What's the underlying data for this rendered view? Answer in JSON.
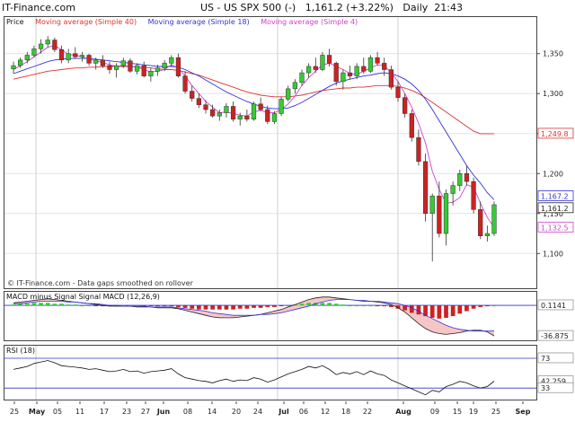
{
  "header": {
    "site": "IT-Finance.com",
    "ticker_line": "US - US SPX 500 (-)   1,161.2 (+3.22%)   Daily  21:43"
  },
  "main_legend": {
    "price_label": "Price",
    "ma40_label": "Moving average (Simple 40)",
    "ma18_label": "Moving average (Simple 18)",
    "ma4_label": "Moving average (Simple 4)",
    "source_note": "© IT-Finance.com - Data gaps smoothed on rollover"
  },
  "macd_legend": {
    "label": "MACD minus Signal Signal MACD (12,26,9)"
  },
  "rsi_legend": {
    "label": "RSI (18)"
  },
  "colors": {
    "up": "#33cc33",
    "down": "#cc2222",
    "ma40": "#dd3333",
    "ma18": "#3333dd",
    "ma4": "#cc44cc",
    "macd_fill": "#f4b8b8",
    "rsi_line": "#111111",
    "guide": "#3333cc"
  },
  "chart_data": [
    {
      "type": "candlestick",
      "panel": "price",
      "yticks": [
        "1,350",
        "1,300",
        "1,250",
        "1,200",
        "1,150",
        "1,100"
      ],
      "ylim": [
        1070,
        1380
      ],
      "xticks": [
        "25",
        "May",
        "05",
        "11",
        "17",
        "23",
        "27",
        "Jun",
        "08",
        "14",
        "20",
        "24",
        "Jul",
        "06",
        "12",
        "18",
        "22",
        "Aug",
        "09",
        "15",
        "19",
        "25",
        "Sep"
      ],
      "value_badges": [
        {
          "text": "1,249.8",
          "color": "#dd3333"
        },
        {
          "text": "1,167.2",
          "color": "#3333dd"
        },
        {
          "text": "1,161.2",
          "color": "#222222"
        },
        {
          "text": "1,132.5",
          "color": "#cc44cc"
        }
      ],
      "candles_ohlc": [
        [
          1331,
          1340,
          1325,
          1335
        ],
        [
          1335,
          1345,
          1332,
          1342
        ],
        [
          1342,
          1352,
          1338,
          1348
        ],
        [
          1348,
          1360,
          1345,
          1356
        ],
        [
          1356,
          1368,
          1350,
          1362
        ],
        [
          1362,
          1372,
          1358,
          1367
        ],
        [
          1367,
          1370,
          1352,
          1355
        ],
        [
          1355,
          1360,
          1338,
          1342
        ],
        [
          1342,
          1356,
          1338,
          1350
        ],
        [
          1350,
          1358,
          1344,
          1346
        ],
        [
          1346,
          1352,
          1340,
          1348
        ],
        [
          1348,
          1350,
          1335,
          1338
        ],
        [
          1338,
          1345,
          1330,
          1342
        ],
        [
          1342,
          1348,
          1332,
          1335
        ],
        [
          1335,
          1340,
          1325,
          1330
        ],
        [
          1330,
          1338,
          1320,
          1335
        ],
        [
          1335,
          1345,
          1332,
          1341
        ],
        [
          1341,
          1344,
          1326,
          1328
        ],
        [
          1328,
          1338,
          1324,
          1335
        ],
        [
          1335,
          1340,
          1320,
          1322
        ],
        [
          1322,
          1332,
          1315,
          1328
        ],
        [
          1328,
          1336,
          1322,
          1332
        ],
        [
          1332,
          1342,
          1328,
          1338
        ],
        [
          1338,
          1348,
          1334,
          1345
        ],
        [
          1345,
          1350,
          1320,
          1322
        ],
        [
          1322,
          1328,
          1300,
          1303
        ],
        [
          1303,
          1310,
          1290,
          1294
        ],
        [
          1294,
          1300,
          1282,
          1286
        ],
        [
          1286,
          1292,
          1275,
          1280
        ],
        [
          1280,
          1286,
          1270,
          1272
        ],
        [
          1272,
          1280,
          1266,
          1276
        ],
        [
          1276,
          1288,
          1270,
          1284
        ],
        [
          1284,
          1290,
          1265,
          1268
        ],
        [
          1268,
          1276,
          1260,
          1272
        ],
        [
          1272,
          1280,
          1265,
          1268
        ],
        [
          1268,
          1290,
          1266,
          1287
        ],
        [
          1287,
          1295,
          1278,
          1280
        ],
        [
          1280,
          1285,
          1262,
          1265
        ],
        [
          1265,
          1278,
          1262,
          1275
        ],
        [
          1275,
          1296,
          1272,
          1293
        ],
        [
          1293,
          1310,
          1290,
          1306
        ],
        [
          1306,
          1318,
          1300,
          1314
        ],
        [
          1314,
          1330,
          1310,
          1326
        ],
        [
          1326,
          1338,
          1320,
          1334
        ],
        [
          1334,
          1345,
          1326,
          1330
        ],
        [
          1330,
          1352,
          1328,
          1348
        ],
        [
          1348,
          1356,
          1334,
          1338
        ],
        [
          1338,
          1340,
          1310,
          1315
        ],
        [
          1315,
          1330,
          1305,
          1326
        ],
        [
          1326,
          1335,
          1318,
          1322
        ],
        [
          1322,
          1338,
          1318,
          1334
        ],
        [
          1334,
          1345,
          1325,
          1328
        ],
        [
          1328,
          1348,
          1326,
          1345
        ],
        [
          1345,
          1352,
          1335,
          1338
        ],
        [
          1338,
          1345,
          1322,
          1330
        ],
        [
          1330,
          1335,
          1305,
          1308
        ],
        [
          1308,
          1315,
          1290,
          1295
        ],
        [
          1295,
          1300,
          1270,
          1275
        ],
        [
          1275,
          1280,
          1240,
          1245
        ],
        [
          1245,
          1255,
          1210,
          1215
        ],
        [
          1215,
          1225,
          1140,
          1150
        ],
        [
          1150,
          1175,
          1090,
          1172
        ],
        [
          1172,
          1190,
          1120,
          1125
        ],
        [
          1125,
          1180,
          1110,
          1175
        ],
        [
          1175,
          1190,
          1160,
          1185
        ],
        [
          1185,
          1205,
          1178,
          1200
        ],
        [
          1200,
          1210,
          1185,
          1190
        ],
        [
          1190,
          1195,
          1150,
          1155
        ],
        [
          1155,
          1165,
          1118,
          1122
        ],
        [
          1122,
          1135,
          1115,
          1125
        ],
        [
          1125,
          1165,
          1122,
          1161
        ]
      ],
      "ma40": [
        1318,
        1320,
        1322,
        1324,
        1326,
        1328,
        1329,
        1330,
        1331,
        1332,
        1332,
        1333,
        1333,
        1334,
        1334,
        1334,
        1334,
        1334,
        1333,
        1333,
        1332,
        1331,
        1330,
        1330,
        1329,
        1327,
        1325,
        1323,
        1320,
        1317,
        1314,
        1311,
        1308,
        1305,
        1302,
        1300,
        1298,
        1297,
        1296,
        1296,
        1296,
        1297,
        1298,
        1300,
        1302,
        1304,
        1305,
        1306,
        1307,
        1307,
        1308,
        1308,
        1309,
        1310,
        1310,
        1310,
        1309,
        1307,
        1304,
        1300,
        1295,
        1289,
        1283,
        1277,
        1271,
        1265,
        1259,
        1253,
        1249.8,
        1249.8,
        1249.8
      ],
      "ma18": [
        1325,
        1328,
        1331,
        1334,
        1337,
        1340,
        1342,
        1343,
        1344,
        1344,
        1344,
        1344,
        1343,
        1342,
        1341,
        1340,
        1339,
        1338,
        1337,
        1336,
        1335,
        1334,
        1334,
        1334,
        1333,
        1330,
        1326,
        1322,
        1317,
        1312,
        1307,
        1302,
        1298,
        1294,
        1290,
        1287,
        1284,
        1282,
        1281,
        1281,
        1282,
        1285,
        1289,
        1294,
        1299,
        1304,
        1309,
        1313,
        1316,
        1318,
        1320,
        1322,
        1323,
        1325,
        1326,
        1325,
        1322,
        1318,
        1312,
        1304,
        1293,
        1280,
        1266,
        1252,
        1238,
        1224,
        1210,
        1198,
        1188,
        1176,
        1167.2
      ],
      "ma4": [
        1330,
        1335,
        1340,
        1346,
        1352,
        1358,
        1360,
        1355,
        1349,
        1348,
        1346,
        1343,
        1341,
        1339,
        1336,
        1334,
        1335,
        1334,
        1333,
        1330,
        1327,
        1328,
        1330,
        1336,
        1332,
        1322,
        1310,
        1300,
        1290,
        1283,
        1276,
        1277,
        1275,
        1273,
        1272,
        1277,
        1279,
        1276,
        1276,
        1280,
        1287,
        1297,
        1310,
        1320,
        1328,
        1336,
        1338,
        1334,
        1330,
        1325,
        1324,
        1328,
        1332,
        1336,
        1335,
        1326,
        1315,
        1300,
        1283,
        1263,
        1238,
        1203,
        1180,
        1163,
        1164,
        1170,
        1186,
        1183,
        1163,
        1145,
        1132.5
      ]
    },
    {
      "type": "bar+line",
      "panel": "macd",
      "yticks": [
        "0.1141",
        "-36.875"
      ],
      "ylim": [
        -40,
        12
      ],
      "histogram": [
        1,
        2,
        2,
        3,
        3,
        3,
        2,
        2,
        1,
        1,
        0,
        0,
        -1,
        -1,
        -1,
        -1,
        0,
        0,
        0,
        -1,
        -1,
        -1,
        -1,
        -1,
        -2,
        -3,
        -4,
        -5,
        -5,
        -5,
        -5,
        -5,
        -5,
        -4,
        -4,
        -3,
        -3,
        -2,
        -2,
        -1,
        0,
        1,
        2,
        3,
        3,
        3,
        3,
        2,
        1,
        0,
        0,
        0,
        0,
        -1,
        -1,
        -2,
        -4,
        -6,
        -9,
        -11,
        -13,
        -15,
        -16,
        -15,
        -13,
        -10,
        -7,
        -4,
        -2,
        -1,
        0
      ],
      "macd": [
        3,
        4,
        5,
        6,
        7,
        8,
        7,
        6,
        5,
        4,
        3,
        2,
        1,
        0,
        -1,
        -1,
        -1,
        -1,
        -2,
        -2,
        -2,
        -3,
        -3,
        -3,
        -4,
        -6,
        -8,
        -10,
        -12,
        -14,
        -15,
        -15,
        -15,
        -14,
        -13,
        -12,
        -11,
        -9,
        -7,
        -5,
        -2,
        1,
        4,
        7,
        9,
        10,
        10,
        9,
        8,
        7,
        6,
        5,
        5,
        4,
        3,
        1,
        -3,
        -8,
        -15,
        -22,
        -28,
        -32,
        -34,
        -35,
        -34,
        -33,
        -31,
        -30,
        -30,
        -32,
        -36.875
      ],
      "signal": [
        2,
        2,
        3,
        4,
        5,
        5,
        5,
        5,
        4,
        4,
        3,
        2,
        2,
        1,
        0,
        0,
        -1,
        -1,
        -1,
        -1,
        -2,
        -2,
        -2,
        -2,
        -3,
        -4,
        -5,
        -6,
        -7,
        -9,
        -10,
        -11,
        -12,
        -12,
        -12,
        -12,
        -11,
        -11,
        -10,
        -9,
        -7,
        -5,
        -3,
        -1,
        2,
        4,
        6,
        7,
        7,
        7,
        6,
        6,
        5,
        5,
        4,
        3,
        2,
        0,
        -3,
        -7,
        -12,
        -16,
        -20,
        -24,
        -27,
        -29,
        -30,
        -31,
        -31,
        -31,
        -31
      ]
    },
    {
      "type": "line",
      "panel": "rsi",
      "yticks": [
        "73",
        "42.259",
        "33"
      ],
      "ylim": [
        20,
        85
      ],
      "guides": [
        73,
        33
      ],
      "rsi": [
        58,
        60,
        62,
        66,
        68,
        70,
        67,
        63,
        62,
        61,
        60,
        58,
        59,
        57,
        55,
        56,
        58,
        55,
        56,
        53,
        55,
        56,
        57,
        59,
        52,
        47,
        45,
        43,
        42,
        40,
        43,
        45,
        42,
        44,
        43,
        47,
        45,
        41,
        44,
        48,
        52,
        55,
        58,
        62,
        60,
        63,
        58,
        51,
        54,
        52,
        55,
        51,
        56,
        52,
        50,
        44,
        40,
        36,
        32,
        28,
        24,
        30,
        28,
        35,
        38,
        42,
        40,
        36,
        33,
        35,
        42.259
      ]
    }
  ]
}
